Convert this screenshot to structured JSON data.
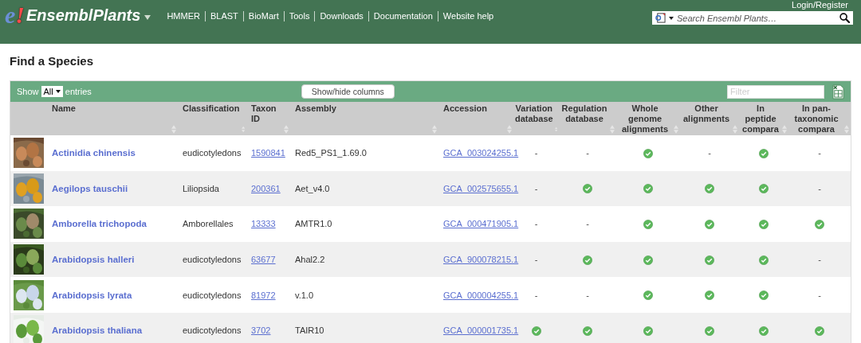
{
  "header": {
    "logo_mark": "e!",
    "site_name": "EnsemblPlants",
    "nav": [
      "HMMER",
      "BLAST",
      "BioMart",
      "Tools",
      "Downloads",
      "Documentation",
      "Website help"
    ],
    "account_link": "Login/Register",
    "search": {
      "placeholder": "Search Ensembl Plants…"
    }
  },
  "page_title": "Find a Species",
  "table": {
    "show_label": "Show",
    "page_size": "All",
    "entries_label": "entries",
    "columns_button": "Show/hide columns",
    "filter": {
      "placeholder": "Filter"
    },
    "columns": [
      {
        "label": "Name",
        "kind": "text"
      },
      {
        "label": "Classification",
        "kind": "text"
      },
      {
        "label": "Taxon ID",
        "kind": "text"
      },
      {
        "label": "Assembly",
        "kind": "text"
      },
      {
        "label": "Accession",
        "kind": "text"
      },
      {
        "label": "Variation database",
        "kind": "flag"
      },
      {
        "label": "Regulation database",
        "kind": "flag"
      },
      {
        "label": "Whole genome alignments",
        "kind": "flag"
      },
      {
        "label": "Other alignments",
        "kind": "flag"
      },
      {
        "label": "In peptide compara",
        "kind": "flag"
      },
      {
        "label": "In pan-taxonomic compara",
        "kind": "flag"
      }
    ],
    "rows": [
      {
        "thumb": {
          "kind": "picture"
        },
        "name": "Actinidia chinensis",
        "classification": "eudicotyledons",
        "taxon_id": "1590841",
        "assembly": "Red5_PS1_1.69.0",
        "accession": "GCA_003024255.1",
        "flags": [
          false,
          false,
          true,
          false,
          true,
          false
        ]
      },
      {
        "thumb": {
          "kind": "picture"
        },
        "name": "Aegilops tauschii",
        "classification": "Liliopsida",
        "taxon_id": "200361",
        "assembly": "Aet_v4.0",
        "accession": "GCA_002575655.1",
        "flags": [
          false,
          true,
          true,
          true,
          true,
          false
        ]
      },
      {
        "thumb": {
          "kind": "picture"
        },
        "name": "Amborella trichopoda",
        "classification": "Amborellales",
        "taxon_id": "13333",
        "assembly": "AMTR1.0",
        "accession": "GCA_000471905.1",
        "flags": [
          false,
          false,
          true,
          true,
          true,
          true
        ]
      },
      {
        "thumb": {
          "kind": "picture"
        },
        "name": "Arabidopsis halleri",
        "classification": "eudicotyledons",
        "taxon_id": "63677",
        "assembly": "Ahal2.2",
        "accession": "GCA_900078215.1",
        "flags": [
          false,
          true,
          true,
          true,
          true,
          false
        ]
      },
      {
        "thumb": {
          "kind": "picture"
        },
        "name": "Arabidopsis lyrata",
        "classification": "eudicotyledons",
        "taxon_id": "81972",
        "assembly": "v.1.0",
        "accession": "GCA_000004255.1",
        "flags": [
          false,
          false,
          true,
          true,
          true,
          false
        ]
      },
      {
        "thumb": {
          "kind": "picture"
        },
        "name": "Arabidopsis thaliana",
        "classification": "eudicotyledons",
        "taxon_id": "3702",
        "assembly": "TAIR10",
        "accession": "GCA_000001735.1",
        "flags": [
          true,
          true,
          true,
          true,
          true,
          true
        ]
      }
    ],
    "absent_mark": "-"
  }
}
